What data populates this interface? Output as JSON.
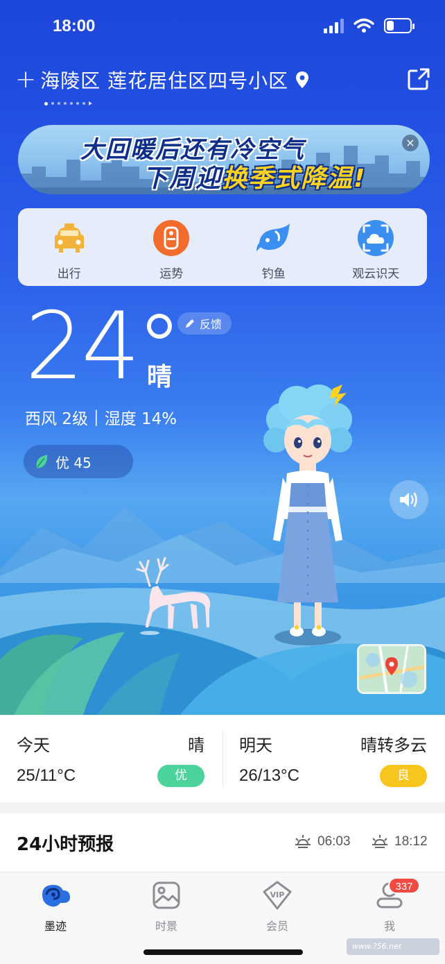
{
  "status_bar": {
    "time": "18:00",
    "battery_level": 0.3
  },
  "header": {
    "location": "海陵区 莲花居住区四号小区",
    "page_count": 7,
    "active_page": 0
  },
  "banner": {
    "line1": "大回暖后还有冷空气",
    "line2_prefix": "下周迎",
    "line2_highlight": "换季式降温!",
    "close_symbol": "×"
  },
  "quick_actions": [
    {
      "label": "出行",
      "icon": "taxi-icon",
      "color": "#f3b23a"
    },
    {
      "label": "运势",
      "icon": "fortune-icon",
      "color": "#f26d2b"
    },
    {
      "label": "钓鱼",
      "icon": "fish-icon",
      "color": "#3a8ff0"
    },
    {
      "label": "观云识天",
      "icon": "cloud-scan-icon",
      "color": "#3a8ff0"
    }
  ],
  "current": {
    "temperature": "24",
    "condition": "晴",
    "feedback_label": "反馈",
    "wind": "西风 2级",
    "separator": "|",
    "humidity": "湿度 14%",
    "aqi_label": "优 45"
  },
  "forecast": {
    "today": {
      "day": "今天",
      "condition": "晴",
      "temp": "25/11°C",
      "aqi": "优",
      "aqi_color": "#4cd39b"
    },
    "tomorrow": {
      "day": "明天",
      "condition": "晴转多云",
      "temp": "26/13°C",
      "aqi": "良",
      "aqi_color": "#f8c51c"
    }
  },
  "hourly": {
    "title": "24小时预报",
    "sunrise": "06:03",
    "sunset": "18:12"
  },
  "tabs": [
    {
      "label": "墨迹",
      "icon": "moji-home-icon",
      "active": true
    },
    {
      "label": "时景",
      "icon": "picture-icon",
      "active": false
    },
    {
      "label": "会员",
      "icon": "vip-icon",
      "active": false
    },
    {
      "label": "我",
      "icon": "profile-icon",
      "active": false,
      "badge": "337"
    }
  ],
  "watermark": "www.?56.net"
}
